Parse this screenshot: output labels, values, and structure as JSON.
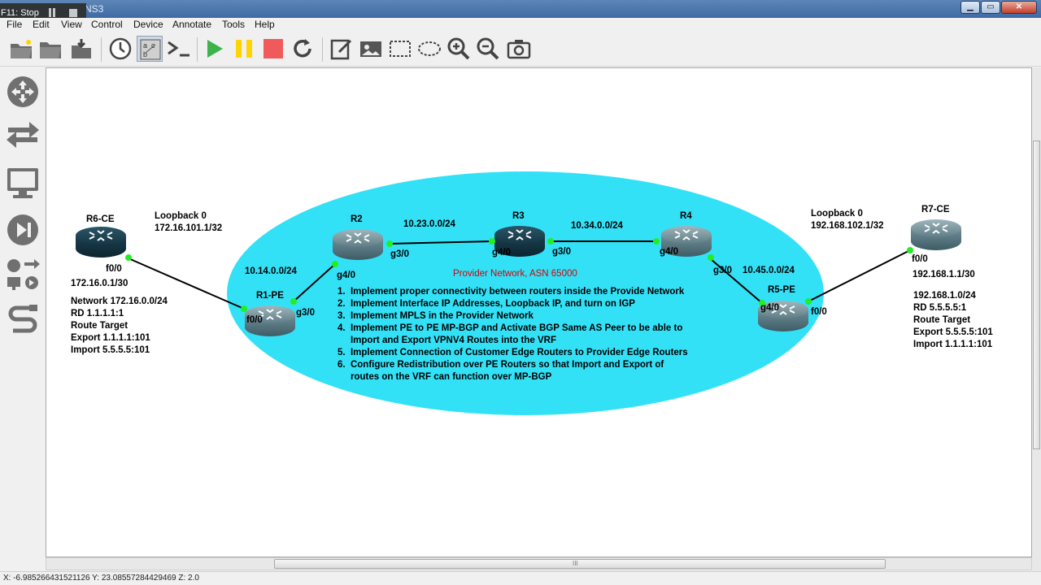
{
  "window": {
    "title": "NS3",
    "buttons": {
      "minimize": "▁",
      "maximize": "▭",
      "close": "✕"
    }
  },
  "recorder": {
    "label": "F11: Stop"
  },
  "menu": {
    "items": [
      "File",
      "Edit",
      "View",
      "Control",
      "Device",
      "Annotate",
      "Tools",
      "Help"
    ]
  },
  "toolbar": {
    "icons": [
      "open-folder-new-icon",
      "open-folder-icon",
      "save-icon",
      "clock-icon",
      "node-labels-icon",
      "console-icon",
      "start-icon",
      "pause-icon",
      "stop-icon",
      "reload-icon",
      "note-icon",
      "picture-icon",
      "rectangle-icon",
      "ellipse-icon",
      "zoom-in-icon",
      "zoom-out-icon",
      "screenshot-icon"
    ]
  },
  "dock": {
    "icons": [
      "router-category-icon",
      "switch-category-icon",
      "end-device-icon",
      "security-device-icon",
      "all-devices-icon",
      "link-icon"
    ]
  },
  "topology": {
    "provider": {
      "title": "Provider Network, ASN 65000",
      "tasks": [
        "1.  Implement proper connectivity between routers inside the Provide Network",
        "2.  Implement Interface IP Addresses, Loopback IP, and turn on IGP",
        "3.  Implement MPLS in the Provider Network",
        "4.  Implement PE to PE MP-BGP and Activate BGP Same AS Peer to be able to",
        "     Import and Export VPNV4 Routes into the VRF",
        "5.  Implement Connection of Customer Edge Routers to Provider Edge Routers",
        "6.  Configure Redistribution over PE Routers so that Import and Export of",
        "     routes on the VRF can function over MP-BGP"
      ]
    },
    "routers": {
      "r6": "R6-CE",
      "r1": "R1-PE",
      "r2": "R2",
      "r3": "R3",
      "r4": "R4",
      "r5": "R5-PE",
      "r7": "R7-CE"
    },
    "interfaces": {
      "r6_f00": "f0/0",
      "r1_f00": "f0/0",
      "r1_g30": "g3/0",
      "r2_g40": "g4/0",
      "r2_g30": "g3/0",
      "r3_g40": "g4/0",
      "r3_g30": "g3/0",
      "r4_g40": "g4/0",
      "r4_g30": "g3/0",
      "r5_g40": "g4/0",
      "r5_f00": "f0/0",
      "r7_f00": "f0/0"
    },
    "subnets": {
      "r1_r2": "10.14.0.0/24",
      "r2_r3": "10.23.0.0/24",
      "r3_r4": "10.34.0.0/24",
      "r4_r5": "10.45.0.0/24"
    },
    "left_notes": {
      "loopback_title": "Loopback 0",
      "loopback_ip": "172.16.101.1/32",
      "ce_ip": "172.16.0.1/30",
      "network": "Network 172.16.0.0/24",
      "rd": "RD 1.1.1.1:1",
      "rt": "Route Target",
      "export": "Export 1.1.1.1:101",
      "import": "Import 5.5.5.5:101"
    },
    "right_notes": {
      "loopback_title": "Loopback 0",
      "loopback_ip": "192.168.102.1/32",
      "ce_ip": "192.168.1.1/30",
      "network": "192.168.1.0/24",
      "rd": "RD 5.5.5.5:1",
      "rt": "Route Target",
      "export": "Export 5.5.5.5:101",
      "import": "Import 1.1.1.1:101"
    }
  },
  "colors": {
    "ellipse_fill": "#33e1f7",
    "link_dot": "#22ee22",
    "title_red": "#d40000",
    "router_body": "#1f4a5c"
  },
  "scrollbar": {
    "grip": "III"
  },
  "status": {
    "coords": "X: -6.985266431521126 Y: 23.08557284429469 Z: 2.0"
  }
}
